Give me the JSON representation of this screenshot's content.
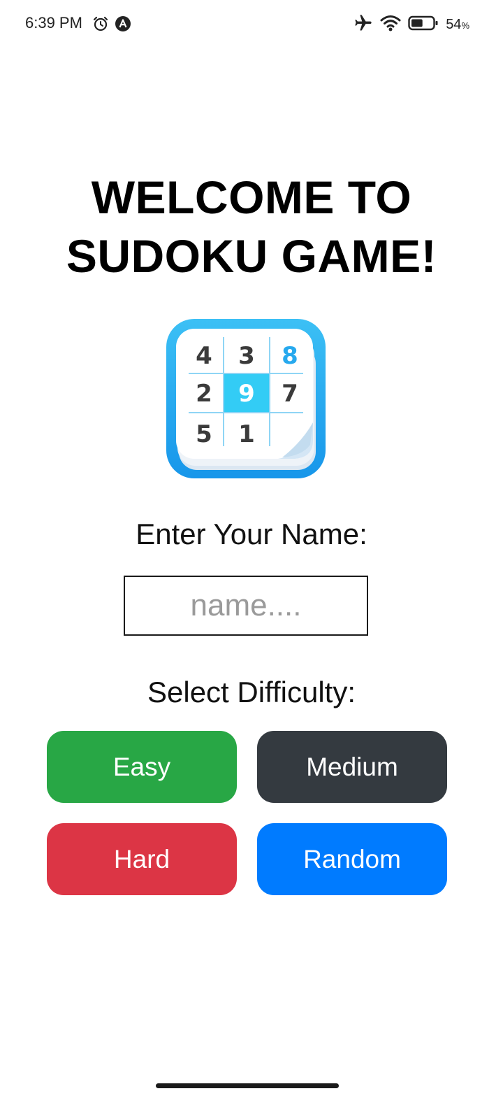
{
  "status_bar": {
    "time": "6:39 PM",
    "battery_percent": "54",
    "battery_symbol": "%",
    "battery_level": 0.54,
    "icons": [
      "alarm-icon",
      "notification-a-icon",
      "airplane-mode-icon",
      "wifi-icon",
      "battery-icon"
    ]
  },
  "main": {
    "title_line1": "WELCOME TO",
    "title_line2": "SUDOKU GAME!",
    "logo": {
      "icon": "sudoku-logo-icon",
      "cells": [
        "4",
        "3",
        "8",
        "2",
        "9",
        "7",
        "5",
        "1",
        ""
      ]
    },
    "name_label": "Enter Your Name:",
    "name_input": {
      "value": "",
      "placeholder": "name...."
    },
    "difficulty_label": "Select Difficulty:",
    "buttons": {
      "easy": "Easy",
      "medium": "Medium",
      "hard": "Hard",
      "random": "Random"
    }
  },
  "colors": {
    "easy": "#28a745",
    "medium": "#343a40",
    "hard": "#dc3545",
    "random": "#007bff",
    "logo_blue": "#23a6ee",
    "logo_highlight": "#33ccf5"
  }
}
